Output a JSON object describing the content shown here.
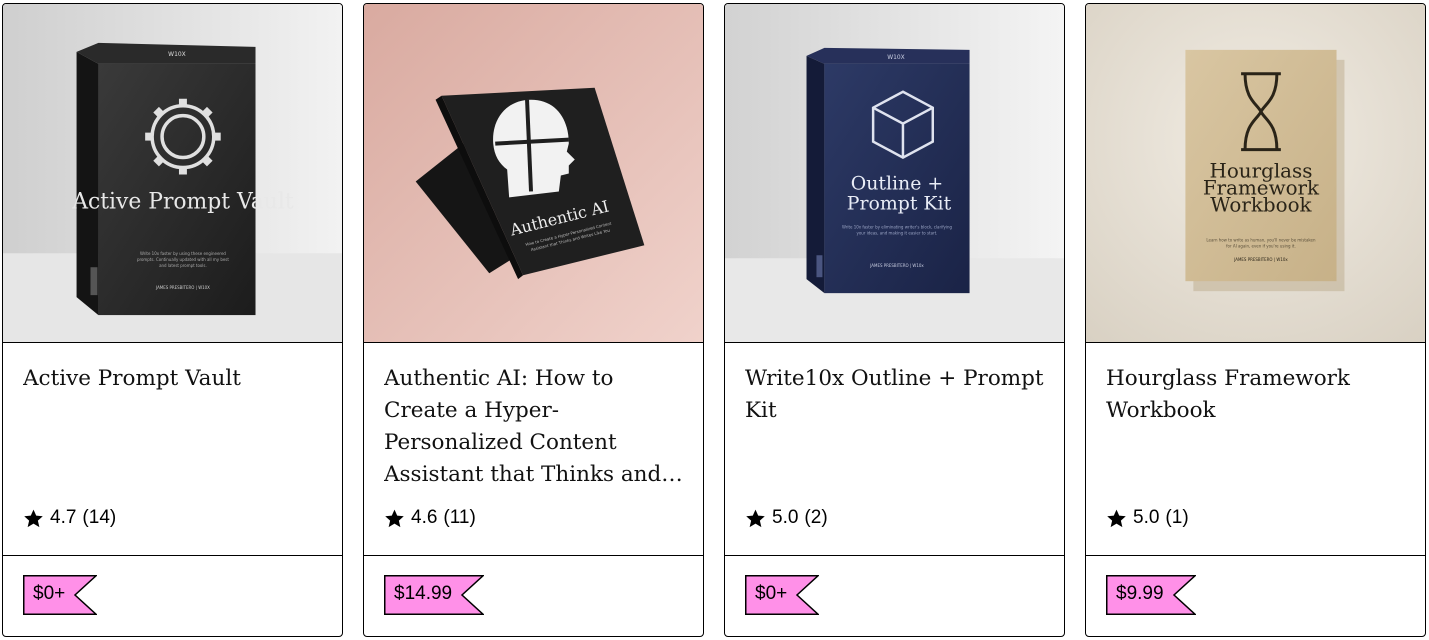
{
  "products": [
    {
      "title": "Active Prompt Vault",
      "rating": "4.7",
      "reviews": "(14)",
      "price": "$0+",
      "cover_icon": "gear-icon",
      "cover_title": "Active Prompt Vault",
      "cover_line1": "Write 10x faster by using these engineered",
      "cover_line2": "prompts. Continually updated with all my best",
      "cover_line3": "and latest prompt tools.",
      "cover_author": "JAMES PRESBITERO | W10X",
      "cover_brand": "W10X"
    },
    {
      "title": "Authentic AI: How to Create a Hyper-Personalized Content Assistant that Thinks and Writes Like...",
      "rating": "4.6",
      "reviews": "(11)",
      "price": "$14.99",
      "cover_icon": "head-silhouette-icon",
      "cover_title": "Authentic AI",
      "cover_line1": "How to Create a Hyper-Personalized Content",
      "cover_line2": "Assistant that Thinks and Writes Like You",
      "cover_line3": ""
    },
    {
      "title": "Write10x Outline + Prompt Kit",
      "rating": "5.0",
      "reviews": "(2)",
      "price": "$0+",
      "cover_icon": "cube-icon",
      "cover_title_1": "Outline +",
      "cover_title_2": "Prompt Kit",
      "cover_line1": "Write 10x faster by eliminating writer's block, clarifying",
      "cover_line2": "your ideas, and making it easier to start.",
      "cover_author": "JAMES PRESBITERO | W10x",
      "cover_brand": "W10X"
    },
    {
      "title": "Hourglass Framework Workbook",
      "rating": "5.0",
      "reviews": "(1)",
      "price": "$9.99",
      "cover_icon": "hourglass-icon",
      "cover_title_1": "Hourglass",
      "cover_title_2": "Framework",
      "cover_title_3": "Workbook",
      "cover_line1": "Learn how to write as human, you'll never be mistaken",
      "cover_line2": "for AI again, even if you're using it.",
      "cover_author": "JAMES PRESBITERO | W10x"
    }
  ],
  "colors": {
    "price_tag": "#ff90e8",
    "border": "#000000",
    "card_bg": "#ffffff"
  }
}
